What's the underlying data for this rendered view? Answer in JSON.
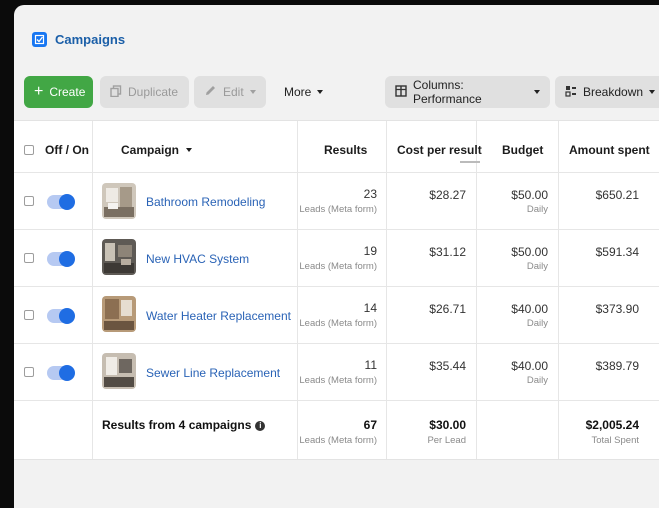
{
  "header": {
    "title": "Campaigns"
  },
  "toolbar": {
    "create": "Create",
    "duplicate": "Duplicate",
    "edit": "Edit",
    "more": "More",
    "columns": "Columns: Performance",
    "breakdown": "Breakdown"
  },
  "table": {
    "headers": {
      "toggle": "Off / On",
      "campaign": "Campaign",
      "results": "Results",
      "cost": "Cost per result",
      "budget": "Budget",
      "spent": "Amount spent"
    },
    "rows": [
      {
        "name": "Bathroom Remodeling",
        "results": "23",
        "results_sub": "Leads (Meta form)",
        "cost": "$28.27",
        "budget": "$50.00",
        "budget_sub": "Daily",
        "spent": "$650.21"
      },
      {
        "name": "New HVAC System",
        "results": "19",
        "results_sub": "Leads (Meta form)",
        "cost": "$31.12",
        "budget": "$50.00",
        "budget_sub": "Daily",
        "spent": "$591.34"
      },
      {
        "name": "Water Heater Replacement",
        "results": "14",
        "results_sub": "Leads (Meta form)",
        "cost": "$26.71",
        "budget": "$40.00",
        "budget_sub": "Daily",
        "spent": "$373.90"
      },
      {
        "name": "Sewer Line Replacement",
        "results": "11",
        "results_sub": "Leads (Meta form)",
        "cost": "$35.44",
        "budget": "$40.00",
        "budget_sub": "Daily",
        "spent": "$389.79"
      }
    ],
    "footer": {
      "label": "Results from 4 campaigns",
      "results": "67",
      "results_sub": "Leads (Meta form)",
      "cost": "$30.00",
      "cost_sub": "Per Lead",
      "spent": "$2,005.24",
      "spent_sub": "Total Spent"
    }
  },
  "colors": {
    "accent": "#1877f2",
    "create": "#42a745",
    "link": "#2a63b6"
  }
}
